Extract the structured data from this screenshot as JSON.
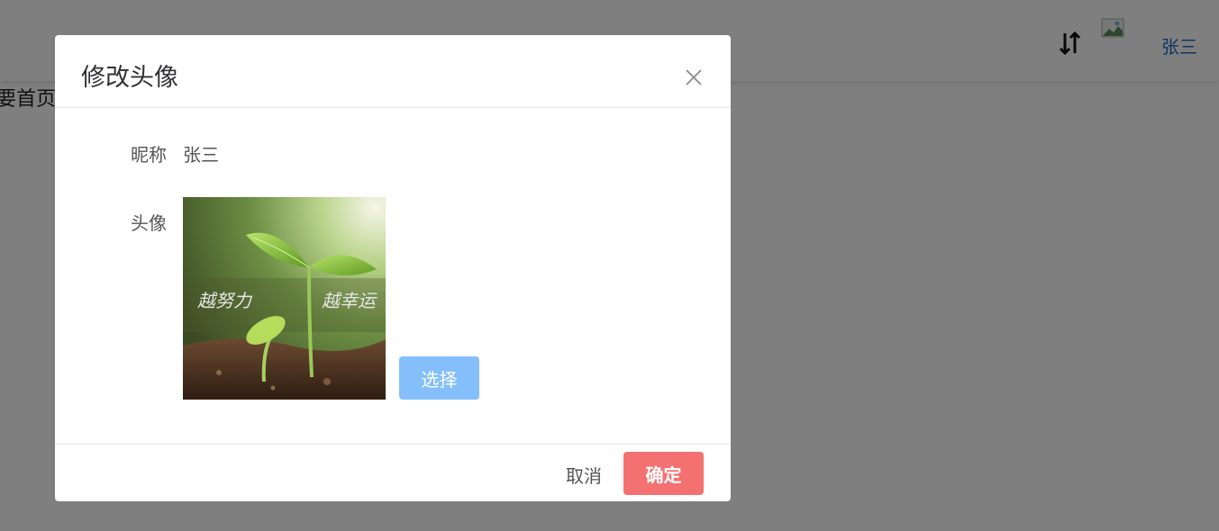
{
  "background": {
    "page_text": "要首页",
    "user_name": "张三",
    "icons": [
      "sort-icon",
      "broken-image-icon"
    ]
  },
  "dialog": {
    "title": "修改头像",
    "nickname_label": "昵称",
    "nickname_value": "张三",
    "avatar_label": "头像",
    "avatar_image_text_left": "越努力",
    "avatar_image_text_right": "越幸运",
    "select_label": "选择",
    "cancel_label": "取消",
    "confirm_label": "确定"
  },
  "colors": {
    "primary_light": "#84bffc",
    "danger_light": "#f47171",
    "link": "#1e6ac9"
  }
}
